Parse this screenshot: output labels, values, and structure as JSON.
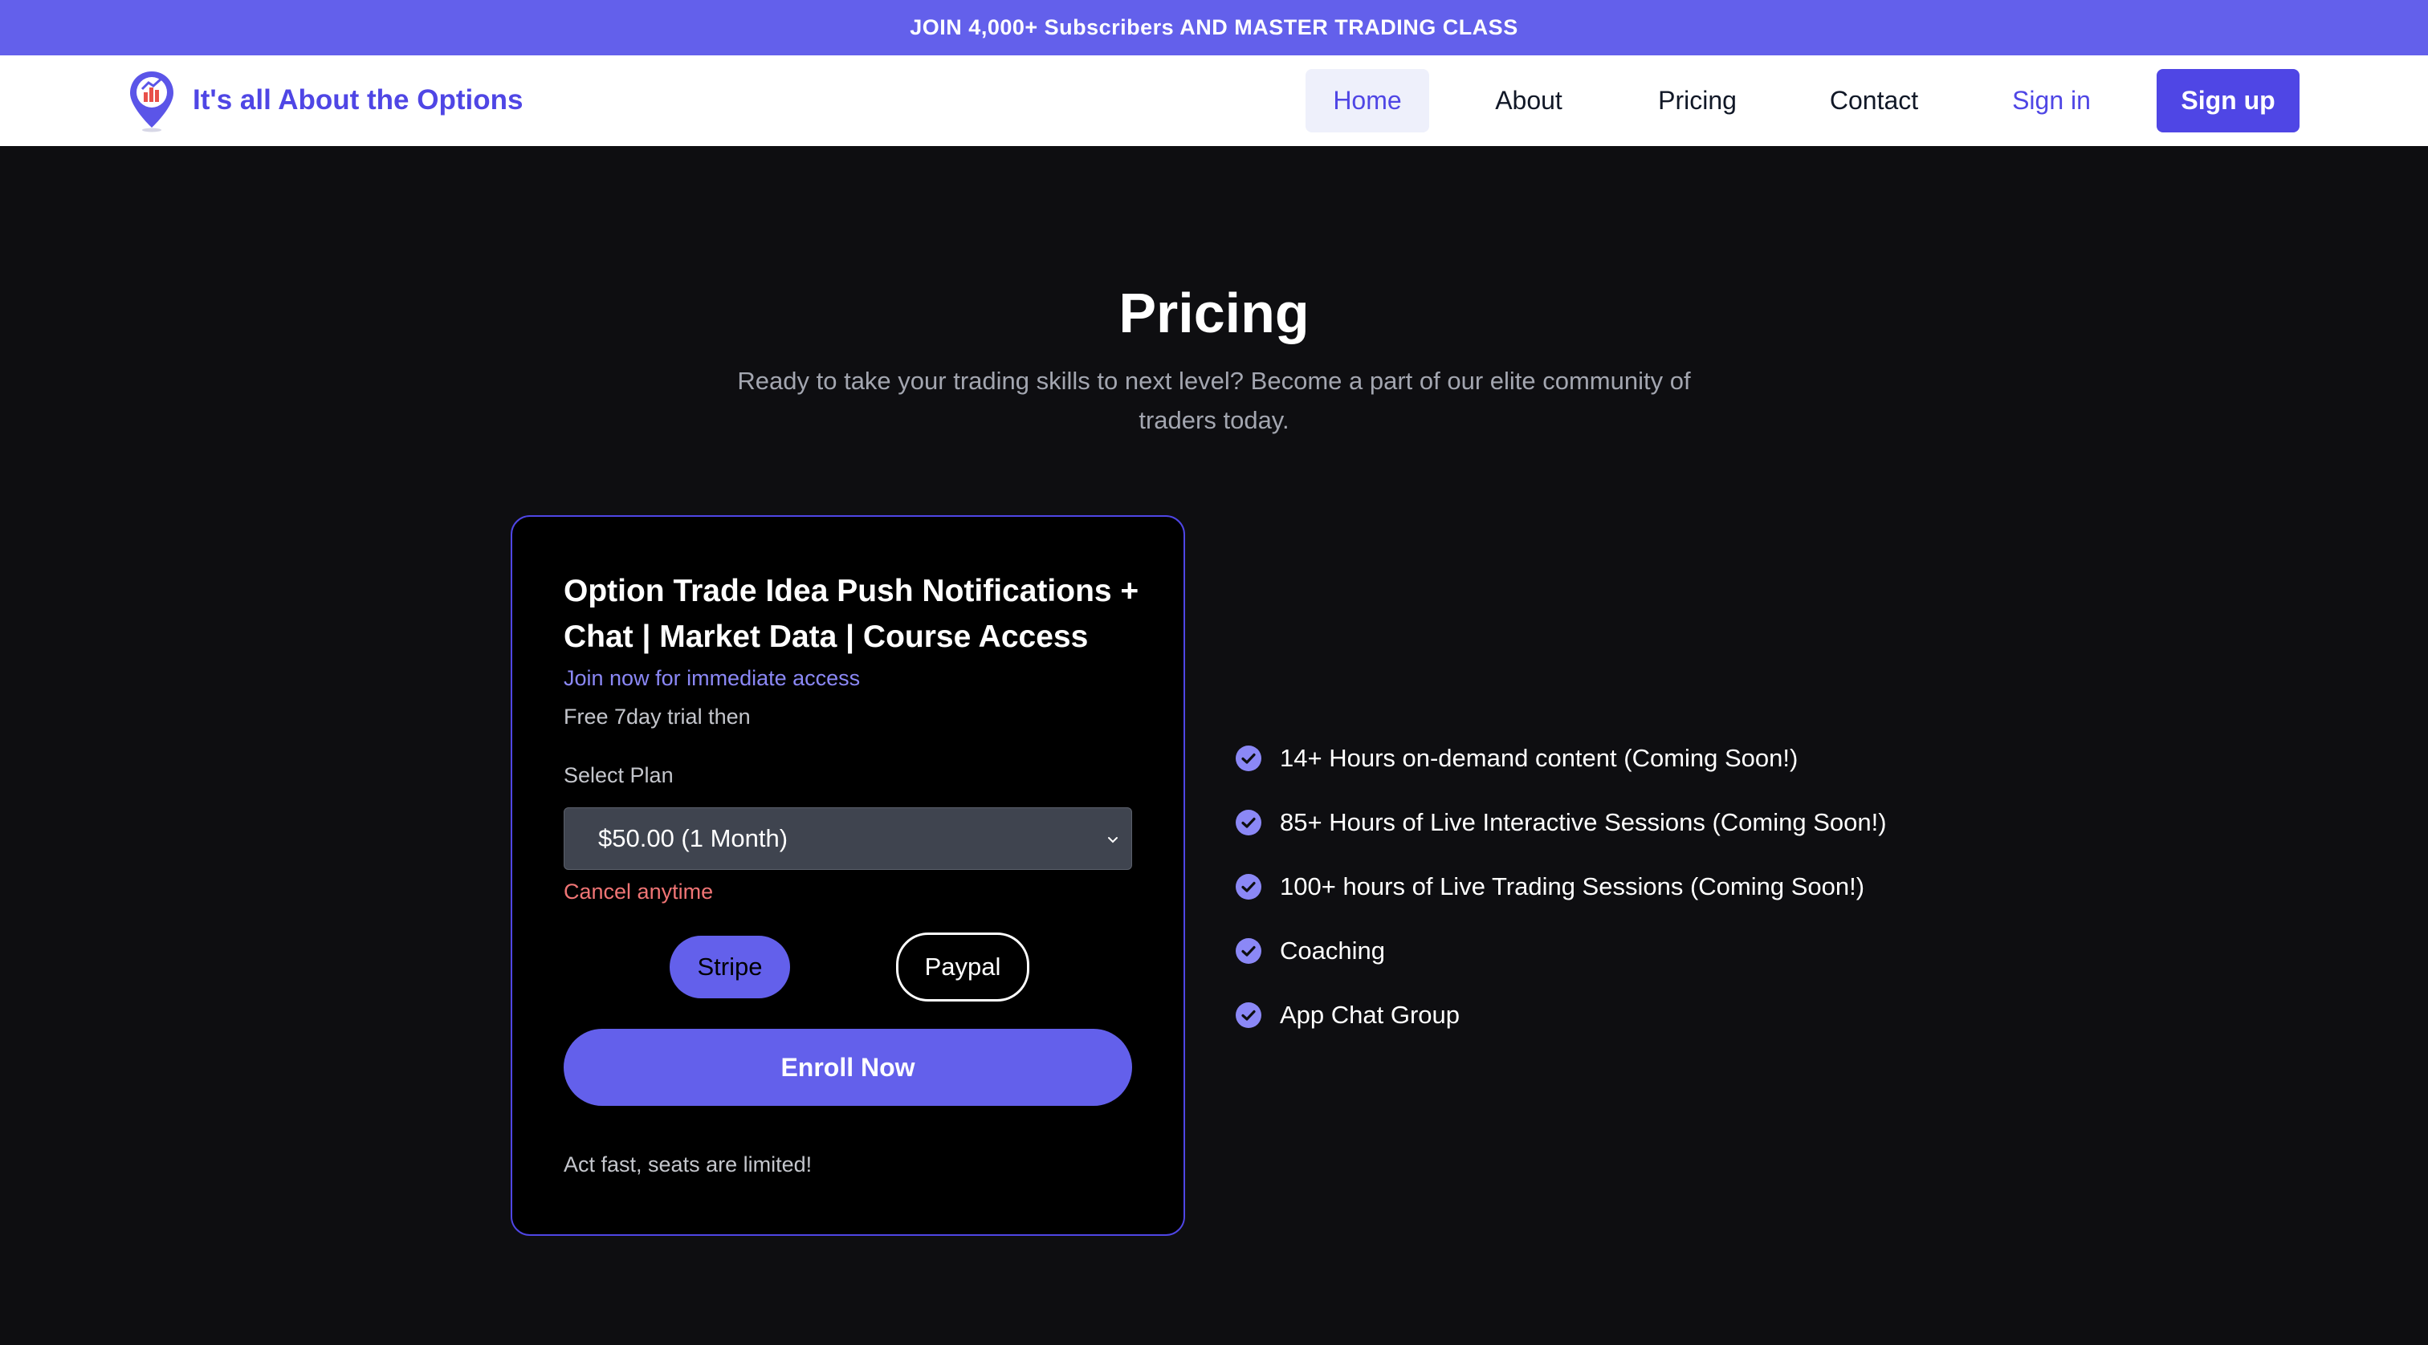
{
  "banner": {
    "text": "JOIN 4,000+ Subscribers AND MASTER TRADING CLASS"
  },
  "brand": {
    "name": "It's all About the Options",
    "logo_icon": "map-pin-chart-icon"
  },
  "nav": {
    "items": [
      {
        "label": "Home",
        "active": true
      },
      {
        "label": "About"
      },
      {
        "label": "Pricing"
      },
      {
        "label": "Contact"
      }
    ],
    "sign_in": "Sign in",
    "sign_up": "Sign up"
  },
  "hero": {
    "title": "Pricing",
    "subtitle": "Ready to take your trading skills to next level? Become a part of our elite community of traders today."
  },
  "card": {
    "title": "Option Trade Idea Push Notifications + Chat | Market Data | Course Access",
    "tagline": "Join now for immediate access",
    "trial": "Free 7day trial then",
    "select_label": "Select Plan",
    "selected_plan": "$50.00 (1 Month)",
    "cancel_note": "Cancel anytime",
    "payment_methods": [
      "Stripe",
      "Paypal"
    ],
    "selected_payment": "Stripe",
    "enroll_label": "Enroll Now",
    "footnote": "Act fast, seats are limited!"
  },
  "features": [
    "14+ Hours on-demand content (Coming Soon!)",
    "85+ Hours of Live Interactive Sessions (Coming Soon!)",
    "100+ hours of Live Trading Sessions (Coming Soon!)",
    "Coaching",
    "App Chat Group"
  ],
  "colors": {
    "accent": "#6360eb",
    "brand": "#4f46e5",
    "background": "#0e0e11",
    "warning": "#f07575"
  }
}
